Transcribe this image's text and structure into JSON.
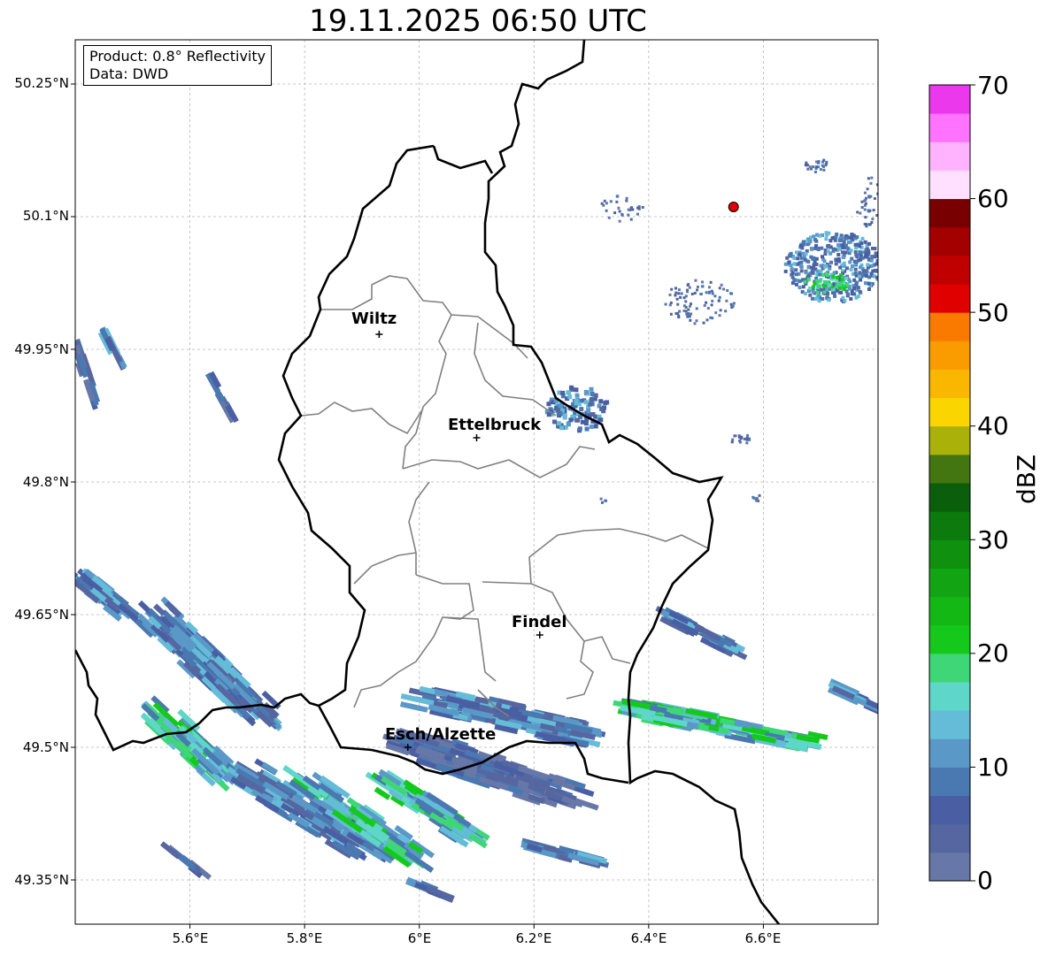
{
  "title": "19.11.2025 06:50 UTC",
  "info": {
    "product": "Product: 0.8° Reflectivity",
    "data": "Data: DWD"
  },
  "lat_labels": [
    "50.25°N",
    "50.1°N",
    "49.95°N",
    "49.8°N",
    "49.65°N",
    "49.5°N",
    "49.35°N"
  ],
  "lon_labels": [
    "5.6°E",
    "5.8°E",
    "6°E",
    "6.2°E",
    "6.4°E",
    "6.6°E"
  ],
  "cities": [
    {
      "name": "Wiltz",
      "lon": 5.93,
      "lat": 49.967
    },
    {
      "name": "Ettelbruck",
      "lon": 6.1,
      "lat": 49.85
    },
    {
      "name": "Findel",
      "lon": 6.21,
      "lat": 49.627
    },
    {
      "name": "Esch/Alzette",
      "lon": 5.98,
      "lat": 49.5
    }
  ],
  "radar_site": {
    "lon": 6.548,
    "lat": 50.111
  },
  "colorbar": {
    "label": "dBZ",
    "ticks": [
      "0",
      "10",
      "20",
      "30",
      "40",
      "50",
      "60",
      "70"
    ],
    "min": 0,
    "max": 70,
    "colors": [
      "#6677a8",
      "#5566a0",
      "#4a5fa3",
      "#4a78b0",
      "#5a98c8",
      "#64bcd8",
      "#5ed6c8",
      "#3ed676",
      "#15c91c",
      "#14b814",
      "#12a412",
      "#10900f",
      "#0c7a0c",
      "#0b5e0b",
      "#437610",
      "#aab20a",
      "#fad500",
      "#fab700",
      "#fa9c00",
      "#fa7a00",
      "#e10000",
      "#c00000",
      "#a30000",
      "#780000",
      "#ffe0ff",
      "#ffb3ff",
      "#ff73ff",
      "#ec38ec"
    ]
  },
  "extent": {
    "lon_min": 5.4,
    "lon_max": 6.8,
    "lat_min": 49.3,
    "lat_max": 50.3
  }
}
